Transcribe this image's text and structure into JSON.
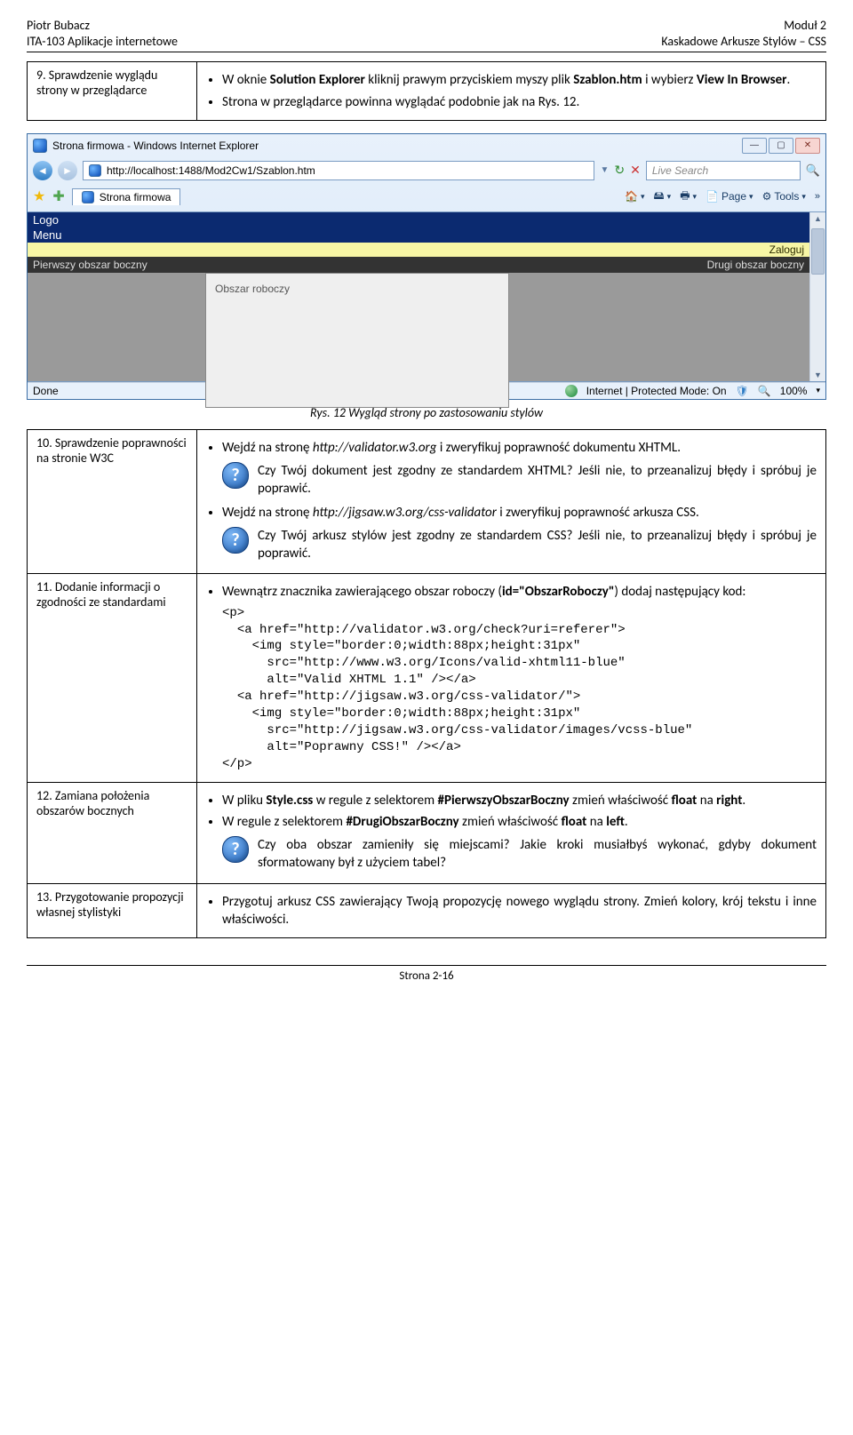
{
  "header": {
    "left_line1": "Piotr Bubacz",
    "left_line2": "ITA-103 Aplikacje internetowe",
    "right_line1": "Moduł 2",
    "right_line2": "Kaskadowe Arkusze Stylów – CSS"
  },
  "section9": {
    "label": "9. Sprawdzenie wyglądu strony w przeglądarce",
    "bullet1_pre": "W oknie ",
    "bullet1_b1": "Solution Explorer",
    "bullet1_mid": " kliknij prawym przyciskiem myszy plik ",
    "bullet1_b2": "Szablon.htm",
    "bullet1_mid2": " i wybierz ",
    "bullet1_b3": "View In Browser",
    "bullet1_end": ".",
    "bullet2": "Strona w przeglądarce powinna wyglądać podobnie jak na Rys. 12."
  },
  "ie": {
    "title": "Strona firmowa - Windows Internet Explorer",
    "url": "http://localhost:1488/Mod2Cw1/Szablon.htm",
    "search_placeholder": "Live Search",
    "tab": "Strona firmowa",
    "tool_page": "Page",
    "tool_tools": "Tools",
    "logo": "Logo",
    "menu": "Menu",
    "zaloguj": "Zaloguj",
    "left_side": "Pierwszy obszar boczny",
    "right_side": "Drugi obszar boczny",
    "center": "Obszar roboczy",
    "status_done": "Done",
    "status_mode": "Internet | Protected Mode: On",
    "zoom": "100%"
  },
  "caption": "Rys. 12 Wygląd strony po zastosowaniu stylów",
  "section10": {
    "label": "10. Sprawdzenie poprawności na stronie W3C",
    "b1_pre": "Wejdź na stronę ",
    "b1_i": "http://validator.w3.org",
    "b1_post": " i zweryfikuj poprawność dokumentu XHTML.",
    "q1": "Czy Twój dokument jest zgodny ze standardem XHTML? Jeśli nie, to przeanalizuj błędy i spróbuj je poprawić.",
    "b2_pre": "Wejdź na stronę ",
    "b2_i": "http://jigsaw.w3.org/css-validator",
    "b2_post": " i zweryfikuj poprawność arkusza CSS.",
    "q2": "Czy Twój arkusz stylów jest zgodny ze standardem CSS? Jeśli nie, to przeanalizuj błędy i spróbuj je poprawić."
  },
  "section11": {
    "label": "11. Dodanie informacji o zgodności ze standardami",
    "b1_pre": "Wewnątrz znacznika zawierającego obszar roboczy (",
    "b1_b": "id=\"ObszarRoboczy\"",
    "b1_post": ") dodaj następujący kod:",
    "code": "<p>\n  <a href=\"http://validator.w3.org/check?uri=referer\">\n    <img style=\"border:0;width:88px;height:31px\"\n      src=\"http://www.w3.org/Icons/valid-xhtml11-blue\"\n      alt=\"Valid XHTML 1.1\" /></a>\n  <a href=\"http://jigsaw.w3.org/css-validator/\">\n    <img style=\"border:0;width:88px;height:31px\"\n      src=\"http://jigsaw.w3.org/css-validator/images/vcss-blue\"\n      alt=\"Poprawny CSS!\" /></a>\n</p>"
  },
  "section12": {
    "label": "12. Zamiana położenia obszarów bocznych",
    "b1_pre": "W pliku ",
    "b1_b1": "Style.css",
    "b1_mid1": " w regule z selektorem ",
    "b1_b2": "#PierwszyObszarBoczny",
    "b1_mid2": " zmień właściwość ",
    "b1_b3": "float",
    "b1_mid3": " na ",
    "b1_b4": "right",
    "b1_end": ".",
    "b2_pre": "W regule z selektorem ",
    "b2_b1": "#DrugiObszarBoczny",
    "b2_mid1": " zmień właściwość ",
    "b2_b2": "float",
    "b2_mid2": " na ",
    "b2_b3": "left",
    "b2_end": ".",
    "q": "Czy oba obszar zamieniły się miejscami? Jakie kroki musiałbyś wykonać, gdyby dokument sformatowany był z użyciem tabel?"
  },
  "section13": {
    "label": "13. Przygotowanie propozycji własnej stylistyki",
    "b1": "Przygotuj arkusz CSS zawierający Twoją propozycję nowego wyglądu strony. Zmień kolory, krój tekstu i inne właściwości."
  },
  "footer": "Strona 2-16"
}
